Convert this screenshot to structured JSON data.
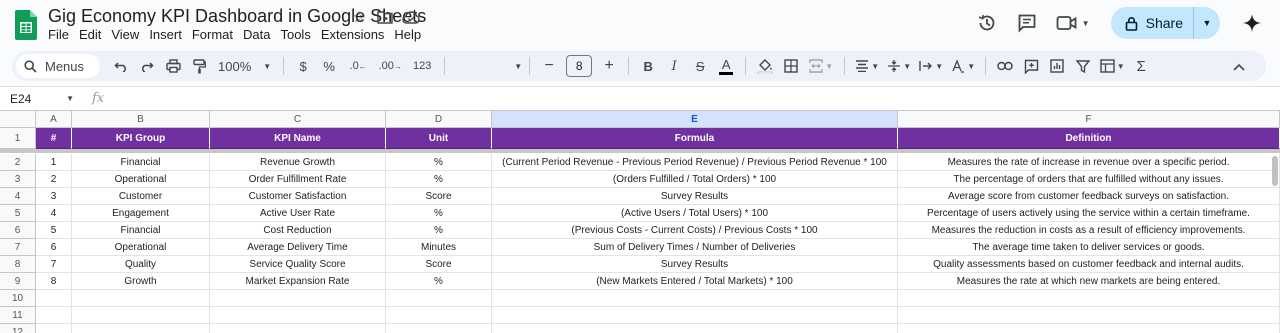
{
  "app": {
    "title": "Gig Economy KPI Dashboard in Google Sheets",
    "menu": [
      "File",
      "Edit",
      "View",
      "Insert",
      "Format",
      "Data",
      "Tools",
      "Extensions",
      "Help"
    ],
    "share_label": "Share",
    "colors": {
      "header_fill": "#7030a0",
      "header_text": "#ffffff",
      "share_bg": "#c2e7ff"
    }
  },
  "toolbar": {
    "menus_label": "Menus",
    "zoom": "100%",
    "currency": "$",
    "percent": "%",
    "dec_decrease": ".0",
    "dec_increase": ".00",
    "number_format": "123",
    "font_size": "8"
  },
  "formula_bar": {
    "name_box": "E24",
    "fx": "fx",
    "content": ""
  },
  "sheet": {
    "columns": [
      "A",
      "B",
      "C",
      "D",
      "E",
      "F"
    ],
    "header": [
      "#",
      "KPI Group",
      "KPI Name",
      "Unit",
      "Formula",
      "Definition"
    ],
    "rows": [
      [
        "1",
        "Financial",
        "Revenue Growth",
        "%",
        "(Current Period Revenue - Previous Period Revenue) / Previous Period Revenue * 100",
        "Measures the rate of increase in revenue over a specific period."
      ],
      [
        "2",
        "Operational",
        "Order Fulfillment Rate",
        "%",
        "(Orders Fulfilled / Total Orders) * 100",
        "The percentage of orders that are fulfilled without any issues."
      ],
      [
        "3",
        "Customer",
        "Customer Satisfaction",
        "Score",
        "Survey Results",
        "Average score from customer feedback surveys on satisfaction."
      ],
      [
        "4",
        "Engagement",
        "Active User Rate",
        "%",
        "(Active Users / Total Users) * 100",
        "Percentage of users actively using the service within a certain timeframe."
      ],
      [
        "5",
        "Financial",
        "Cost Reduction",
        "%",
        "(Previous Costs - Current Costs) / Previous Costs * 100",
        "Measures the reduction in costs as a result of efficiency improvements."
      ],
      [
        "6",
        "Operational",
        "Average Delivery Time",
        "Minutes",
        "Sum of Delivery Times / Number of Deliveries",
        "The average time taken to deliver services or goods."
      ],
      [
        "7",
        "Quality",
        "Service Quality Score",
        "Score",
        "Survey Results",
        "Quality assessments based on customer feedback and internal audits."
      ],
      [
        "8",
        "Growth",
        "Market Expansion Rate",
        "%",
        "(New Markets Entered / Total Markets) * 100",
        "Measures the rate at which new markets are being entered."
      ]
    ],
    "row_numbers": [
      "1",
      "2",
      "3",
      "4",
      "5",
      "6",
      "7",
      "8",
      "9",
      "10",
      "11",
      "12"
    ],
    "selected_column": "E"
  }
}
